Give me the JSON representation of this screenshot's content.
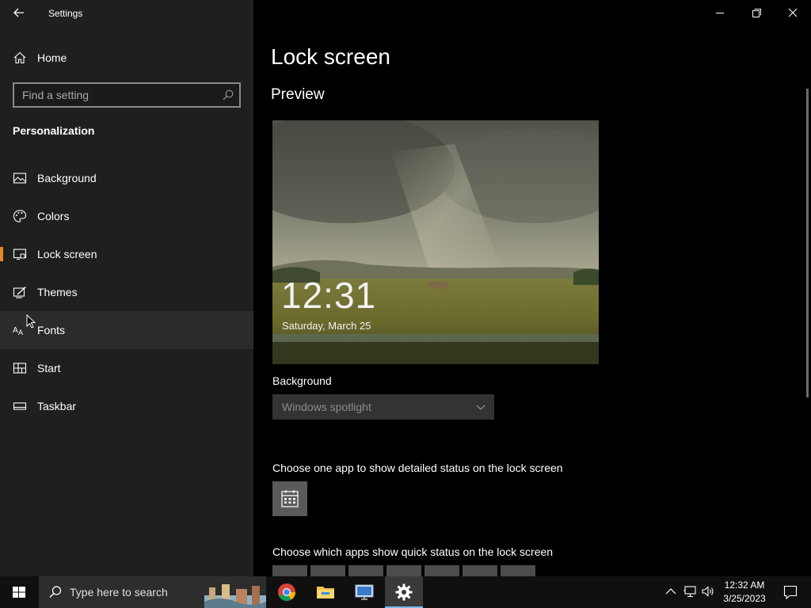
{
  "window": {
    "title": "Settings"
  },
  "sidebar": {
    "home_label": "Home",
    "search_placeholder": "Find a setting",
    "section_title": "Personalization",
    "items": [
      {
        "label": "Background",
        "icon": "picture-icon",
        "selected": false
      },
      {
        "label": "Colors",
        "icon": "palette-icon",
        "selected": false
      },
      {
        "label": "Lock screen",
        "icon": "lock-screen-icon",
        "selected": true
      },
      {
        "label": "Themes",
        "icon": "themes-icon",
        "selected": false
      },
      {
        "label": "Fonts",
        "icon": "fonts-icon",
        "selected": false,
        "hovered": true
      },
      {
        "label": "Start",
        "icon": "start-icon",
        "selected": false
      },
      {
        "label": "Taskbar",
        "icon": "taskbar-icon",
        "selected": false
      }
    ],
    "accent_color": "#e38a2a"
  },
  "main": {
    "title": "Lock screen",
    "preview_label": "Preview",
    "preview_time": "12:31",
    "preview_date": "Saturday, March 25",
    "background_label": "Background",
    "background_value": "Windows spotlight",
    "detailed_status_label": "Choose one app to show detailed status on the lock screen",
    "detailed_status_app": "calendar-icon",
    "quick_status_label": "Choose which apps show quick status on the lock screen"
  },
  "taskbar": {
    "search_placeholder": "Type here to search",
    "apps": [
      "chrome-icon",
      "file-explorer-icon",
      "remote-desktop-icon",
      "settings-icon"
    ],
    "time": "12:32 AM",
    "date": "3/25/2023"
  }
}
